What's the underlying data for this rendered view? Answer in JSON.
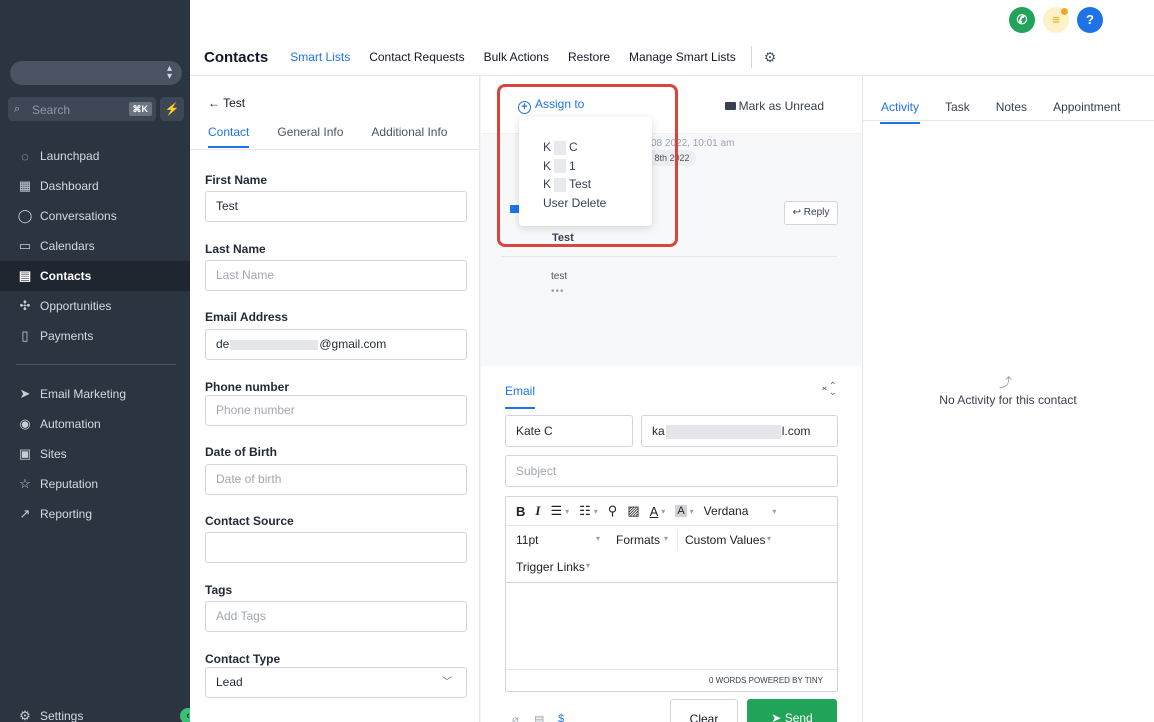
{
  "sidebar": {
    "search_placeholder": "Search",
    "search_shortcut": "⌘K",
    "items": [
      {
        "label": "Launchpad",
        "icon": "launchpad-icon",
        "glyph": "◌"
      },
      {
        "label": "Dashboard",
        "icon": "dashboard-icon",
        "glyph": "▦"
      },
      {
        "label": "Conversations",
        "icon": "conversations-icon",
        "glyph": "◯"
      },
      {
        "label": "Calendars",
        "icon": "calendar-icon",
        "glyph": "▭"
      },
      {
        "label": "Contacts",
        "icon": "contacts-icon",
        "glyph": "▤"
      },
      {
        "label": "Opportunities",
        "icon": "opportunities-icon",
        "glyph": "✣"
      },
      {
        "label": "Payments",
        "icon": "payments-icon",
        "glyph": "▯"
      },
      {
        "label": "Email Marketing",
        "icon": "send-icon",
        "glyph": "➤"
      },
      {
        "label": "Automation",
        "icon": "automation-icon",
        "glyph": "◉"
      },
      {
        "label": "Sites",
        "icon": "sites-icon",
        "glyph": "▣"
      },
      {
        "label": "Reputation",
        "icon": "star-icon",
        "glyph": "☆"
      },
      {
        "label": "Reporting",
        "icon": "reporting-icon",
        "glyph": "↗"
      }
    ],
    "settings_label": "Settings"
  },
  "header": {
    "title": "Contacts",
    "tabs": [
      "Smart Lists",
      "Contact Requests",
      "Bulk Actions",
      "Restore",
      "Manage Smart Lists"
    ],
    "active_tab": "Smart Lists"
  },
  "contact": {
    "back_label": "Test",
    "tabs": [
      "Contact",
      "General Info",
      "Additional Info"
    ],
    "fields": {
      "first_name_label": "First Name",
      "first_name_value": "Test",
      "last_name_label": "Last Name",
      "last_name_placeholder": "Last Name",
      "email_label": "Email Address",
      "email_prefix": "de",
      "email_suffix": "@gmail.com",
      "phone_label": "Phone number",
      "phone_placeholder": "Phone number",
      "dob_label": "Date of Birth",
      "dob_placeholder": "Date of birth",
      "source_label": "Contact Source",
      "source_value": "",
      "tags_label": "Tags",
      "tags_placeholder": "Add Tags",
      "type_label": "Contact Type",
      "type_value": "Lead"
    }
  },
  "conversation": {
    "assign_label": "Assign to",
    "mark_unread_label": "Mark as Unread",
    "date_line": "08 2022, 10:01 am",
    "date_chip": "eb 8th 2022",
    "reply_label": "Reply",
    "subject": "Test",
    "body": "test",
    "more": "•••",
    "assign_menu": [
      {
        "prefix": "K",
        "suffix": "C"
      },
      {
        "prefix": "K",
        "suffix": "1"
      },
      {
        "prefix": "K",
        "suffix": "Test"
      },
      {
        "prefix": "",
        "suffix": "User Delete"
      }
    ]
  },
  "compose": {
    "tab_label": "Email",
    "from_name": "Kate C",
    "from_email_prefix": "ka",
    "from_email_suffix": "l.com",
    "subject_placeholder": "Subject",
    "font_family": "Verdana",
    "font_size": "11pt",
    "formats_label": "Formats",
    "custom_values_label": "Custom Values",
    "trigger_links_label": "Trigger Links",
    "status_text": "0 WORDS POWERED BY TINY",
    "clear_label": "Clear",
    "send_label": "Send"
  },
  "activity": {
    "tabs": [
      "Activity",
      "Task",
      "Notes",
      "Appointment"
    ],
    "empty_text": "No Activity for this contact"
  },
  "colors": {
    "accent": "#1e73e8",
    "sidebar": "#2b3441",
    "send": "#22a35a",
    "highlight": "#d9453a"
  }
}
